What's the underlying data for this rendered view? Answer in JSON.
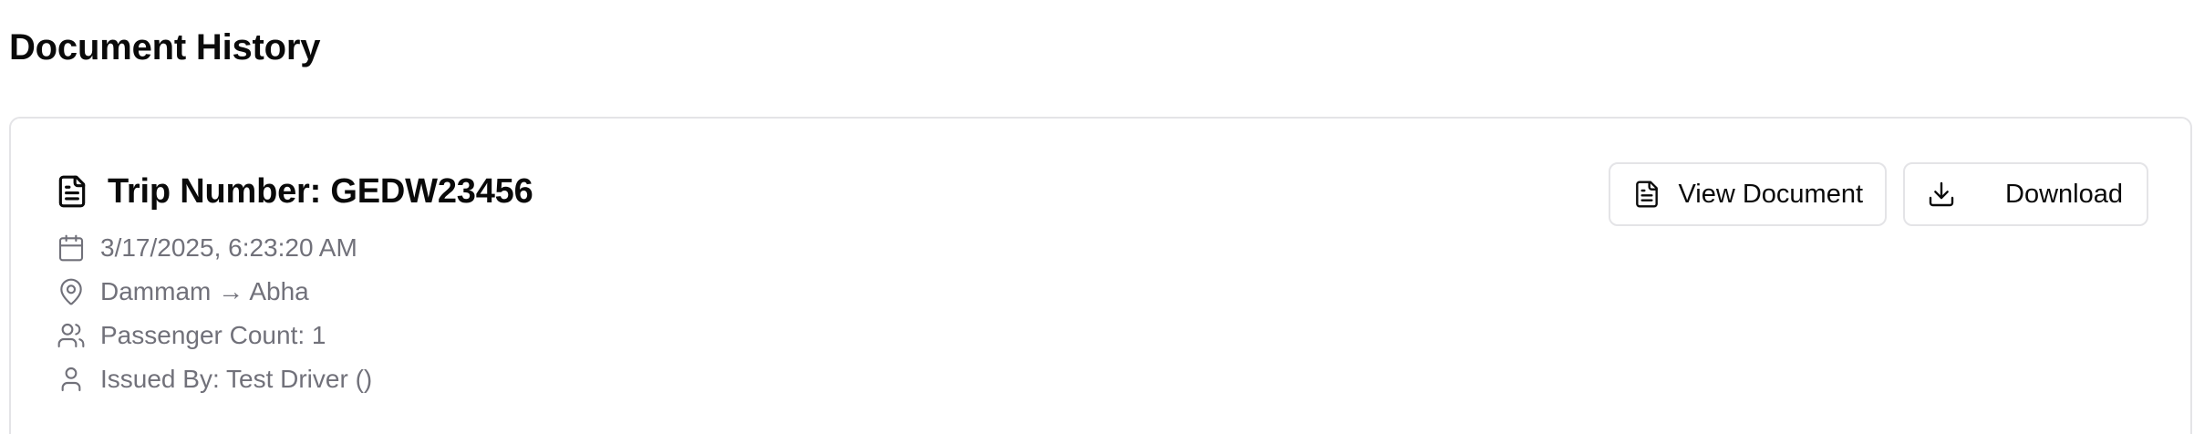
{
  "page": {
    "title": "Document History"
  },
  "documents": [
    {
      "title": "Trip Number: GEDW23456",
      "title_icon": "file-text-icon",
      "meta": [
        {
          "icon": "calendar-icon",
          "text": "3/17/2025, 6:23:20 AM"
        },
        {
          "icon": "map-pin-icon",
          "text": "Dammam → Abha"
        },
        {
          "icon": "users-icon",
          "text": "Passenger Count: 1"
        },
        {
          "icon": "user-icon",
          "text": "Issued By: Test Driver ()"
        }
      ],
      "actions": {
        "view_label": "View Document",
        "view_icon": "file-text-icon",
        "download_label": "Download",
        "download_icon": "download-icon"
      }
    }
  ],
  "colors": {
    "text_primary": "#0a0a0a",
    "text_muted": "#71717a",
    "border": "#e4e4e7",
    "background": "#ffffff"
  }
}
